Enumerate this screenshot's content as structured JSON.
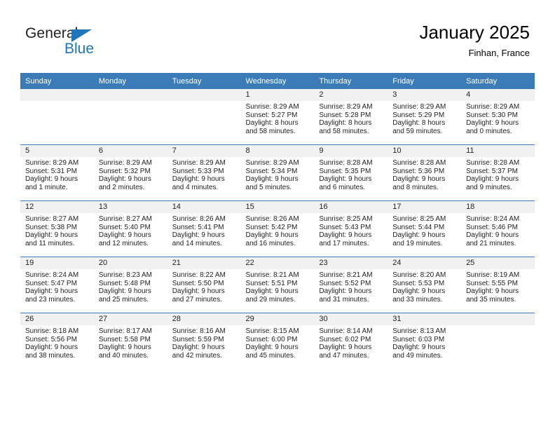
{
  "brand": {
    "name_part1": "General",
    "name_part2": "Blue",
    "accent_color": "#1f76bc"
  },
  "header": {
    "title": "January 2025",
    "subtitle": "Finhan, France"
  },
  "theme": {
    "header_row_color": "#3b7cb8",
    "day_band_color": "#f1f1f1",
    "text_color": "#222222"
  },
  "weekday_headers": [
    "Sunday",
    "Monday",
    "Tuesday",
    "Wednesday",
    "Thursday",
    "Friday",
    "Saturday"
  ],
  "weeks": [
    [
      {
        "empty": true,
        "day": "",
        "sunrise": "",
        "sunset": "",
        "daylight1": "",
        "daylight2": ""
      },
      {
        "empty": true,
        "day": "",
        "sunrise": "",
        "sunset": "",
        "daylight1": "",
        "daylight2": ""
      },
      {
        "empty": true,
        "day": "",
        "sunrise": "",
        "sunset": "",
        "daylight1": "",
        "daylight2": ""
      },
      {
        "empty": false,
        "day": "1",
        "sunrise": "Sunrise: 8:29 AM",
        "sunset": "Sunset: 5:27 PM",
        "daylight1": "Daylight: 8 hours",
        "daylight2": "and 58 minutes."
      },
      {
        "empty": false,
        "day": "2",
        "sunrise": "Sunrise: 8:29 AM",
        "sunset": "Sunset: 5:28 PM",
        "daylight1": "Daylight: 8 hours",
        "daylight2": "and 58 minutes."
      },
      {
        "empty": false,
        "day": "3",
        "sunrise": "Sunrise: 8:29 AM",
        "sunset": "Sunset: 5:29 PM",
        "daylight1": "Daylight: 8 hours",
        "daylight2": "and 59 minutes."
      },
      {
        "empty": false,
        "day": "4",
        "sunrise": "Sunrise: 8:29 AM",
        "sunset": "Sunset: 5:30 PM",
        "daylight1": "Daylight: 9 hours",
        "daylight2": "and 0 minutes."
      }
    ],
    [
      {
        "empty": false,
        "day": "5",
        "sunrise": "Sunrise: 8:29 AM",
        "sunset": "Sunset: 5:31 PM",
        "daylight1": "Daylight: 9 hours",
        "daylight2": "and 1 minute."
      },
      {
        "empty": false,
        "day": "6",
        "sunrise": "Sunrise: 8:29 AM",
        "sunset": "Sunset: 5:32 PM",
        "daylight1": "Daylight: 9 hours",
        "daylight2": "and 2 minutes."
      },
      {
        "empty": false,
        "day": "7",
        "sunrise": "Sunrise: 8:29 AM",
        "sunset": "Sunset: 5:33 PM",
        "daylight1": "Daylight: 9 hours",
        "daylight2": "and 4 minutes."
      },
      {
        "empty": false,
        "day": "8",
        "sunrise": "Sunrise: 8:29 AM",
        "sunset": "Sunset: 5:34 PM",
        "daylight1": "Daylight: 9 hours",
        "daylight2": "and 5 minutes."
      },
      {
        "empty": false,
        "day": "9",
        "sunrise": "Sunrise: 8:28 AM",
        "sunset": "Sunset: 5:35 PM",
        "daylight1": "Daylight: 9 hours",
        "daylight2": "and 6 minutes."
      },
      {
        "empty": false,
        "day": "10",
        "sunrise": "Sunrise: 8:28 AM",
        "sunset": "Sunset: 5:36 PM",
        "daylight1": "Daylight: 9 hours",
        "daylight2": "and 8 minutes."
      },
      {
        "empty": false,
        "day": "11",
        "sunrise": "Sunrise: 8:28 AM",
        "sunset": "Sunset: 5:37 PM",
        "daylight1": "Daylight: 9 hours",
        "daylight2": "and 9 minutes."
      }
    ],
    [
      {
        "empty": false,
        "day": "12",
        "sunrise": "Sunrise: 8:27 AM",
        "sunset": "Sunset: 5:38 PM",
        "daylight1": "Daylight: 9 hours",
        "daylight2": "and 11 minutes."
      },
      {
        "empty": false,
        "day": "13",
        "sunrise": "Sunrise: 8:27 AM",
        "sunset": "Sunset: 5:40 PM",
        "daylight1": "Daylight: 9 hours",
        "daylight2": "and 12 minutes."
      },
      {
        "empty": false,
        "day": "14",
        "sunrise": "Sunrise: 8:26 AM",
        "sunset": "Sunset: 5:41 PM",
        "daylight1": "Daylight: 9 hours",
        "daylight2": "and 14 minutes."
      },
      {
        "empty": false,
        "day": "15",
        "sunrise": "Sunrise: 8:26 AM",
        "sunset": "Sunset: 5:42 PM",
        "daylight1": "Daylight: 9 hours",
        "daylight2": "and 16 minutes."
      },
      {
        "empty": false,
        "day": "16",
        "sunrise": "Sunrise: 8:25 AM",
        "sunset": "Sunset: 5:43 PM",
        "daylight1": "Daylight: 9 hours",
        "daylight2": "and 17 minutes."
      },
      {
        "empty": false,
        "day": "17",
        "sunrise": "Sunrise: 8:25 AM",
        "sunset": "Sunset: 5:44 PM",
        "daylight1": "Daylight: 9 hours",
        "daylight2": "and 19 minutes."
      },
      {
        "empty": false,
        "day": "18",
        "sunrise": "Sunrise: 8:24 AM",
        "sunset": "Sunset: 5:46 PM",
        "daylight1": "Daylight: 9 hours",
        "daylight2": "and 21 minutes."
      }
    ],
    [
      {
        "empty": false,
        "day": "19",
        "sunrise": "Sunrise: 8:24 AM",
        "sunset": "Sunset: 5:47 PM",
        "daylight1": "Daylight: 9 hours",
        "daylight2": "and 23 minutes."
      },
      {
        "empty": false,
        "day": "20",
        "sunrise": "Sunrise: 8:23 AM",
        "sunset": "Sunset: 5:48 PM",
        "daylight1": "Daylight: 9 hours",
        "daylight2": "and 25 minutes."
      },
      {
        "empty": false,
        "day": "21",
        "sunrise": "Sunrise: 8:22 AM",
        "sunset": "Sunset: 5:50 PM",
        "daylight1": "Daylight: 9 hours",
        "daylight2": "and 27 minutes."
      },
      {
        "empty": false,
        "day": "22",
        "sunrise": "Sunrise: 8:21 AM",
        "sunset": "Sunset: 5:51 PM",
        "daylight1": "Daylight: 9 hours",
        "daylight2": "and 29 minutes."
      },
      {
        "empty": false,
        "day": "23",
        "sunrise": "Sunrise: 8:21 AM",
        "sunset": "Sunset: 5:52 PM",
        "daylight1": "Daylight: 9 hours",
        "daylight2": "and 31 minutes."
      },
      {
        "empty": false,
        "day": "24",
        "sunrise": "Sunrise: 8:20 AM",
        "sunset": "Sunset: 5:53 PM",
        "daylight1": "Daylight: 9 hours",
        "daylight2": "and 33 minutes."
      },
      {
        "empty": false,
        "day": "25",
        "sunrise": "Sunrise: 8:19 AM",
        "sunset": "Sunset: 5:55 PM",
        "daylight1": "Daylight: 9 hours",
        "daylight2": "and 35 minutes."
      }
    ],
    [
      {
        "empty": false,
        "day": "26",
        "sunrise": "Sunrise: 8:18 AM",
        "sunset": "Sunset: 5:56 PM",
        "daylight1": "Daylight: 9 hours",
        "daylight2": "and 38 minutes."
      },
      {
        "empty": false,
        "day": "27",
        "sunrise": "Sunrise: 8:17 AM",
        "sunset": "Sunset: 5:58 PM",
        "daylight1": "Daylight: 9 hours",
        "daylight2": "and 40 minutes."
      },
      {
        "empty": false,
        "day": "28",
        "sunrise": "Sunrise: 8:16 AM",
        "sunset": "Sunset: 5:59 PM",
        "daylight1": "Daylight: 9 hours",
        "daylight2": "and 42 minutes."
      },
      {
        "empty": false,
        "day": "29",
        "sunrise": "Sunrise: 8:15 AM",
        "sunset": "Sunset: 6:00 PM",
        "daylight1": "Daylight: 9 hours",
        "daylight2": "and 45 minutes."
      },
      {
        "empty": false,
        "day": "30",
        "sunrise": "Sunrise: 8:14 AM",
        "sunset": "Sunset: 6:02 PM",
        "daylight1": "Daylight: 9 hours",
        "daylight2": "and 47 minutes."
      },
      {
        "empty": false,
        "day": "31",
        "sunrise": "Sunrise: 8:13 AM",
        "sunset": "Sunset: 6:03 PM",
        "daylight1": "Daylight: 9 hours",
        "daylight2": "and 49 minutes."
      },
      {
        "empty": true,
        "day": "",
        "sunrise": "",
        "sunset": "",
        "daylight1": "",
        "daylight2": ""
      }
    ]
  ]
}
